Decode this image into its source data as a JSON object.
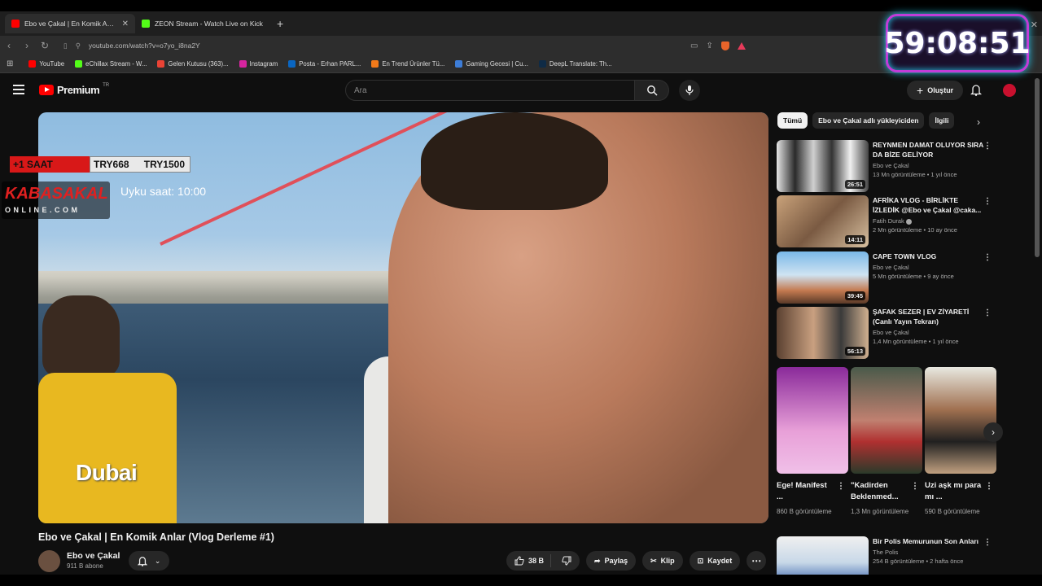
{
  "browser": {
    "tabs": [
      {
        "title": "Ebo ve Çakal | En Komik Anlar",
        "active": true,
        "favicon_color": "#ff0000"
      },
      {
        "title": "ZEON Stream - Watch Live on Kick",
        "active": false,
        "favicon_color": "#53fc18"
      }
    ],
    "url": "youtube.com/watch?v=o7yo_i8na2Y",
    "bookmarks": [
      {
        "label": "YouTube",
        "color": "#ff0000"
      },
      {
        "label": "eChillax Stream - W...",
        "color": "#53fc18"
      },
      {
        "label": "Gelen Kutusu (363)...",
        "color": "#ea4335"
      },
      {
        "label": "Instagram",
        "color": "#d6249f"
      },
      {
        "label": "Posta - Erhan PARL...",
        "color": "#0a66c2"
      },
      {
        "label": "En Trend Ürünler Tü...",
        "color": "#f27a1a"
      },
      {
        "label": "Gaming Gecesi | Cu...",
        "color": "#3d7dd8"
      },
      {
        "label": "DeepL Translate: Th...",
        "color": "#0f2b46"
      }
    ]
  },
  "timer": "59:08:51",
  "youtube": {
    "logo": "Premium",
    "region": "TR",
    "search_placeholder": "Ara",
    "create_label": "Oluştur"
  },
  "video": {
    "title": "Ebo ve Çakal | En Komik Anlar (Vlog Derleme #1)",
    "channel": "Ebo ve Çakal",
    "subscribers": "911 B abone",
    "likes": "38 B",
    "share": "Paylaş",
    "clip": "Klip",
    "save": "Kaydet",
    "overlay": {
      "red_label": "+1 SAAT",
      "price1": "TRY668",
      "price2": "TRY1500",
      "brand_top": "KABASAKAL",
      "brand_bottom": "ONLINE.COM",
      "sleep_text": "Uyku saat: 10:00",
      "scene_text": "Dubai"
    }
  },
  "chips": [
    "Tümü",
    "Ebo ve Çakal adlı yükleyiciden",
    "İlgili"
  ],
  "recommendations": [
    {
      "title": "REYNMEN DAMAT OLUYOR SIRA DA BİZE GELİYOR",
      "channel": "Ebo ve Çakal",
      "meta": "13 Mn görüntüleme • 1 yıl önce",
      "duration": "26:51",
      "verified": false
    },
    {
      "title": "AFRİKA VLOG - BİRLİKTE İZLEDİK @Ebo ve Çakal @caka...",
      "channel": "Fatih Durak",
      "meta": "2 Mn görüntüleme • 10 ay önce",
      "duration": "14:11",
      "verified": true
    },
    {
      "title": "CAPE TOWN VLOG",
      "channel": "Ebo ve Çakal",
      "meta": "5 Mn görüntüleme • 9 ay önce",
      "duration": "39:45",
      "verified": false
    },
    {
      "title": "ŞAFAK SEZER | EV ZİYARETİ (Canlı Yayın Tekrarı)",
      "channel": "Ebo ve Çakal",
      "meta": "1,4 Mn görüntüleme • 1 yıl önce",
      "duration": "56:13",
      "verified": false
    }
  ],
  "shorts": [
    {
      "title": "Ege! Manifest ...",
      "views": "860 B görüntüleme"
    },
    {
      "title": "\"Kadirden Beklenmed...",
      "views": "1,3 Mn görüntüleme"
    },
    {
      "title": "Uzi aşk mı para mı ...",
      "views": "590 B görüntüleme"
    }
  ],
  "last_rec": {
    "title": "Bir Polis Memurunun Son Anları",
    "channel": "The Polis",
    "meta": "254 B görüntüleme • 2 hafta önce"
  }
}
